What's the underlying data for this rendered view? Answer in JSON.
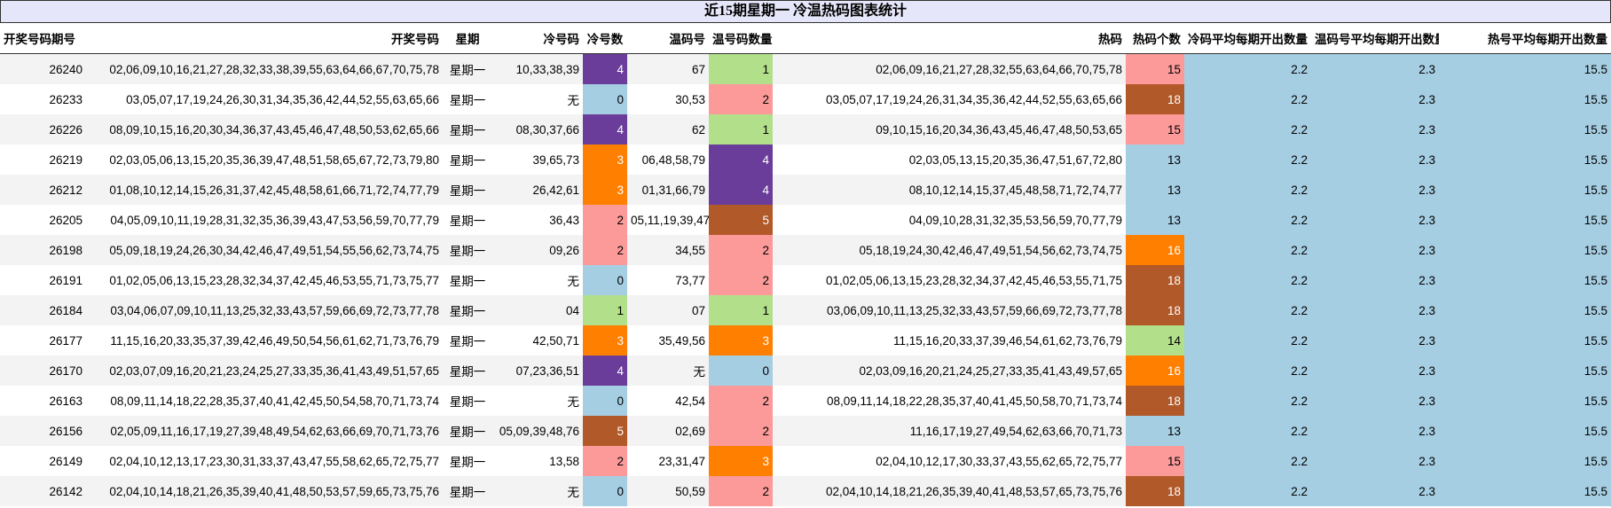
{
  "title": "近15期星期一 冷温热码图表统计",
  "headers": [
    "开奖号码期号",
    "开奖号码",
    "星期",
    "冷号码",
    "冷号数",
    "温码号",
    "温号码数量",
    "热码",
    "热码个数",
    "冷码平均每期开出数量",
    "温码号平均每期开出数量",
    "热号平均每期开出数量"
  ],
  "colors": {
    "0": "#a6cee3",
    "1": "#b2df8a",
    "2": "#fb9a99",
    "3": "#ff7f00",
    "4": "#6a3d9a",
    "5": "#b15928",
    "13": "#a6cee3",
    "14": "#b2df8a",
    "15": "#fb9a99",
    "16": "#ff7f00",
    "18": "#b15928"
  },
  "rows": [
    {
      "issue": "26240",
      "numbers": "02,06,09,10,16,21,27,28,32,33,38,39,55,63,64,66,67,70,75,78",
      "weekday": "星期一",
      "cold": "10,33,38,39",
      "cold_count": "4",
      "warm": "67",
      "warm_count": "1",
      "hot": "02,06,09,16,21,27,28,32,55,63,64,66,70,75,78",
      "hot_count": "15",
      "cold_avg": "2.2",
      "warm_avg": "2.3",
      "hot_avg": "15.5"
    },
    {
      "issue": "26233",
      "numbers": "03,05,07,17,19,24,26,30,31,34,35,36,42,44,52,55,63,65,66",
      "weekday": "星期一",
      "cold": "无",
      "cold_count": "0",
      "warm": "30,53",
      "warm_count": "2",
      "hot": "03,05,07,17,19,24,26,31,34,35,36,42,44,52,55,63,65,66",
      "hot_count": "18",
      "cold_avg": "2.2",
      "warm_avg": "2.3",
      "hot_avg": "15.5"
    },
    {
      "issue": "26226",
      "numbers": "08,09,10,15,16,20,30,34,36,37,43,45,46,47,48,50,53,62,65,66",
      "weekday": "星期一",
      "cold": "08,30,37,66",
      "cold_count": "4",
      "warm": "62",
      "warm_count": "1",
      "hot": "09,10,15,16,20,34,36,43,45,46,47,48,50,53,65",
      "hot_count": "15",
      "cold_avg": "2.2",
      "warm_avg": "2.3",
      "hot_avg": "15.5"
    },
    {
      "issue": "26219",
      "numbers": "02,03,05,06,13,15,20,35,36,39,47,48,51,58,65,67,72,73,79,80",
      "weekday": "星期一",
      "cold": "39,65,73",
      "cold_count": "3",
      "warm": "06,48,58,79",
      "warm_count": "4",
      "hot": "02,03,05,13,15,20,35,36,47,51,67,72,80",
      "hot_count": "13",
      "cold_avg": "2.2",
      "warm_avg": "2.3",
      "hot_avg": "15.5"
    },
    {
      "issue": "26212",
      "numbers": "01,08,10,12,14,15,26,31,37,42,45,48,58,61,66,71,72,74,77,79",
      "weekday": "星期一",
      "cold": "26,42,61",
      "cold_count": "3",
      "warm": "01,31,66,79",
      "warm_count": "4",
      "hot": "08,10,12,14,15,37,45,48,58,71,72,74,77",
      "hot_count": "13",
      "cold_avg": "2.2",
      "warm_avg": "2.3",
      "hot_avg": "15.5"
    },
    {
      "issue": "26205",
      "numbers": "04,05,09,10,11,19,28,31,32,35,36,39,43,47,53,56,59,70,77,79",
      "weekday": "星期一",
      "cold": "36,43",
      "cold_count": "2",
      "warm": "05,11,19,39,47",
      "warm_count": "5",
      "hot": "04,09,10,28,31,32,35,53,56,59,70,77,79",
      "hot_count": "13",
      "cold_avg": "2.2",
      "warm_avg": "2.3",
      "hot_avg": "15.5"
    },
    {
      "issue": "26198",
      "numbers": "05,09,18,19,24,26,30,34,42,46,47,49,51,54,55,56,62,73,74,75",
      "weekday": "星期一",
      "cold": "09,26",
      "cold_count": "2",
      "warm": "34,55",
      "warm_count": "2",
      "hot": "05,18,19,24,30,42,46,47,49,51,54,56,62,73,74,75",
      "hot_count": "16",
      "cold_avg": "2.2",
      "warm_avg": "2.3",
      "hot_avg": "15.5"
    },
    {
      "issue": "26191",
      "numbers": "01,02,05,06,13,15,23,28,32,34,37,42,45,46,53,55,71,73,75,77",
      "weekday": "星期一",
      "cold": "无",
      "cold_count": "0",
      "warm": "73,77",
      "warm_count": "2",
      "hot": "01,02,05,06,13,15,23,28,32,34,37,42,45,46,53,55,71,75",
      "hot_count": "18",
      "cold_avg": "2.2",
      "warm_avg": "2.3",
      "hot_avg": "15.5"
    },
    {
      "issue": "26184",
      "numbers": "03,04,06,07,09,10,11,13,25,32,33,43,57,59,66,69,72,73,77,78",
      "weekday": "星期一",
      "cold": "04",
      "cold_count": "1",
      "warm": "07",
      "warm_count": "1",
      "hot": "03,06,09,10,11,13,25,32,33,43,57,59,66,69,72,73,77,78",
      "hot_count": "18",
      "cold_avg": "2.2",
      "warm_avg": "2.3",
      "hot_avg": "15.5"
    },
    {
      "issue": "26177",
      "numbers": "11,15,16,20,33,35,37,39,42,46,49,50,54,56,61,62,71,73,76,79",
      "weekday": "星期一",
      "cold": "42,50,71",
      "cold_count": "3",
      "warm": "35,49,56",
      "warm_count": "3",
      "hot": "11,15,16,20,33,37,39,46,54,61,62,73,76,79",
      "hot_count": "14",
      "cold_avg": "2.2",
      "warm_avg": "2.3",
      "hot_avg": "15.5"
    },
    {
      "issue": "26170",
      "numbers": "02,03,07,09,16,20,21,23,24,25,27,33,35,36,41,43,49,51,57,65",
      "weekday": "星期一",
      "cold": "07,23,36,51",
      "cold_count": "4",
      "warm": "无",
      "warm_count": "0",
      "hot": "02,03,09,16,20,21,24,25,27,33,35,41,43,49,57,65",
      "hot_count": "16",
      "cold_avg": "2.2",
      "warm_avg": "2.3",
      "hot_avg": "15.5"
    },
    {
      "issue": "26163",
      "numbers": "08,09,11,14,18,22,28,35,37,40,41,42,45,50,54,58,70,71,73,74",
      "weekday": "星期一",
      "cold": "无",
      "cold_count": "0",
      "warm": "42,54",
      "warm_count": "2",
      "hot": "08,09,11,14,18,22,28,35,37,40,41,45,50,58,70,71,73,74",
      "hot_count": "18",
      "cold_avg": "2.2",
      "warm_avg": "2.3",
      "hot_avg": "15.5"
    },
    {
      "issue": "26156",
      "numbers": "02,05,09,11,16,17,19,27,39,48,49,54,62,63,66,69,70,71,73,76",
      "weekday": "星期一",
      "cold": "05,09,39,48,76",
      "cold_count": "5",
      "warm": "02,69",
      "warm_count": "2",
      "hot": "11,16,17,19,27,49,54,62,63,66,70,71,73",
      "hot_count": "13",
      "cold_avg": "2.2",
      "warm_avg": "2.3",
      "hot_avg": "15.5"
    },
    {
      "issue": "26149",
      "numbers": "02,04,10,12,13,17,23,30,31,33,37,43,47,55,58,62,65,72,75,77",
      "weekday": "星期一",
      "cold": "13,58",
      "cold_count": "2",
      "warm": "23,31,47",
      "warm_count": "3",
      "hot": "02,04,10,12,17,30,33,37,43,55,62,65,72,75,77",
      "hot_count": "15",
      "cold_avg": "2.2",
      "warm_avg": "2.3",
      "hot_avg": "15.5"
    },
    {
      "issue": "26142",
      "numbers": "02,04,10,14,18,21,26,35,39,40,41,48,50,53,57,59,65,73,75,76",
      "weekday": "星期一",
      "cold": "无",
      "cold_count": "0",
      "warm": "50,59",
      "warm_count": "2",
      "hot": "02,04,10,14,18,21,26,35,39,40,41,48,53,57,65,73,75,76",
      "hot_count": "18",
      "cold_avg": "2.2",
      "warm_avg": "2.3",
      "hot_avg": "15.5"
    }
  ]
}
